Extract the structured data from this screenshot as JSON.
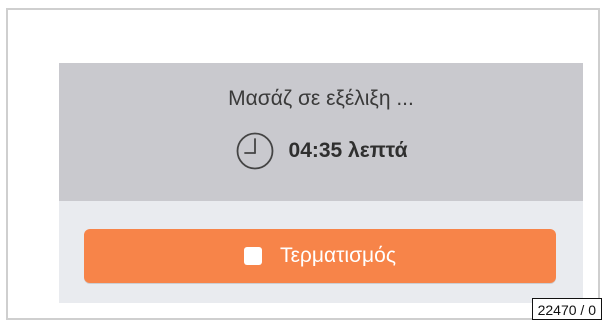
{
  "status": {
    "message": "Μασάζ σε εξέλιξη ...",
    "timer_icon": "clock-icon",
    "timer_value": "04:35 λεπτά"
  },
  "actions": {
    "end_icon": "stop-square-icon",
    "end_label": "Τερματισμός"
  },
  "footer": {
    "reference": "22470 / 0"
  },
  "colors": {
    "frame_border": "#cfcfcf",
    "status_background": "#c9c9ce",
    "panel_background": "#e9ebef",
    "button_background": "#f78449",
    "text_dark": "#2f2f2f",
    "button_text": "#ffffff"
  }
}
